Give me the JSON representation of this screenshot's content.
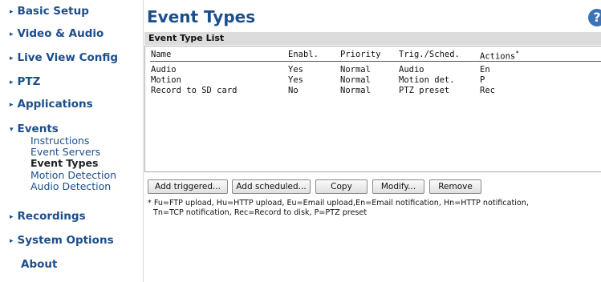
{
  "sidebar": {
    "items": [
      {
        "label": "Basic Setup"
      },
      {
        "label": "Video & Audio"
      },
      {
        "label": "Live View Config"
      },
      {
        "label": "PTZ"
      },
      {
        "label": "Applications"
      },
      {
        "label": "Events",
        "expanded": true,
        "subitems": [
          {
            "label": "Instructions"
          },
          {
            "label": "Event Servers"
          },
          {
            "label": "Event Types",
            "active": true
          },
          {
            "label": "Motion Detection"
          },
          {
            "label": "Audio Detection"
          }
        ]
      },
      {
        "label": "Recordings"
      },
      {
        "label": "System Options"
      },
      {
        "label": "About"
      }
    ],
    "arrow_collapsed": "▸",
    "arrow_expanded": "▾"
  },
  "page": {
    "title": "Event Types",
    "help_glyph": "?"
  },
  "list": {
    "header": "Event Type List",
    "columns": [
      "Name",
      "Enabl.",
      "Priority",
      "Trig./Sched.",
      "Actions"
    ],
    "actions_marker": "*",
    "rows": [
      {
        "name": "Audio",
        "enabled": "Yes",
        "priority": "Normal",
        "trigger": "Audio",
        "actions": "En"
      },
      {
        "name": "Motion",
        "enabled": "Yes",
        "priority": "Normal",
        "trigger": "Motion det.",
        "actions": "P"
      },
      {
        "name": "Record to SD card",
        "enabled": "No",
        "priority": "Normal",
        "trigger": "PTZ preset",
        "actions": "Rec"
      }
    ]
  },
  "buttons": {
    "add_triggered": "Add triggered...",
    "add_scheduled": "Add scheduled...",
    "copy": "Copy",
    "modify": "Modify...",
    "remove": "Remove"
  },
  "footnote": {
    "line1": "* Fu=FTP upload, Hu=HTTP upload, Eu=Email upload,En=Email notification, Hn=HTTP notification,",
    "line2": "Tn=TCP notification, Rec=Record to disk, P=PTZ preset"
  },
  "colors": {
    "link": "#1c4e8c",
    "header_bg": "#dcdcdc",
    "help_icon": "#3a73b8"
  }
}
